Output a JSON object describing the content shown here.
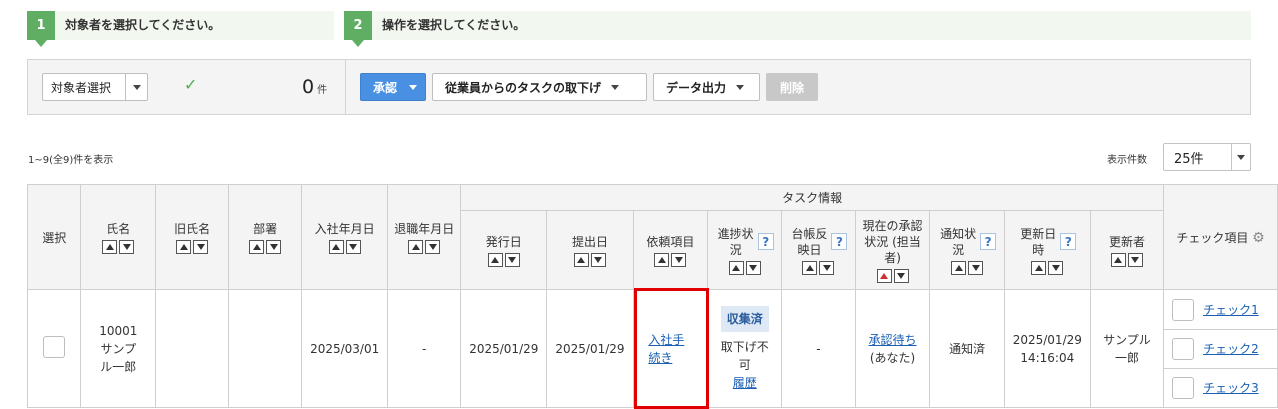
{
  "steps": [
    {
      "num": "1",
      "text": "対象者を選択してください。"
    },
    {
      "num": "2",
      "text": "操作を選択してください。"
    }
  ],
  "selector": {
    "label": "対象者選択",
    "count": "0",
    "unit": "件"
  },
  "actions": {
    "approve": "承認",
    "withdraw": "従業員からのタスクの取下げ",
    "export": "データ出力",
    "delete": "削除"
  },
  "summary": "1~9(全9)件を表示",
  "pageSize": {
    "label": "表示件数",
    "value": "25件"
  },
  "table": {
    "group": "タスク情報",
    "headers": {
      "select": "選択",
      "name": "氏名",
      "oldName": "旧氏名",
      "dept": "部署",
      "hireDate": "入社年月日",
      "retireDate": "退職年月日",
      "issueDate": "発行日",
      "submitDate": "提出日",
      "requestItem": "依頼項目",
      "progress": "進捗状況",
      "ledger": "台帳反映日",
      "approval": "現在の承認状況 (担当者)",
      "notify": "通知状況",
      "updated": "更新日時",
      "updater": "更新者",
      "check": "チェック項目"
    },
    "row": {
      "name": "10001 サンプル一郎",
      "oldName": "",
      "dept": "",
      "hireDate": "2025/03/01",
      "retireDate": "-",
      "issueDate": "2025/01/29",
      "submitDate": "2025/01/29",
      "requestItem": "入社手続き",
      "progressBadge": "収集済",
      "progressNote": "取下げ不可",
      "progressLink": "履歴",
      "ledger": "-",
      "approvalLink": "承認待ち",
      "approvalWho": "(あなた)",
      "notify": "通知済",
      "updated": "2025/01/29 14:16:04",
      "updater": "サンプル一郎",
      "checks": [
        "チェック1",
        "チェック2",
        "チェック3"
      ]
    }
  },
  "colors": {
    "green": "#5fae63",
    "blue": "#4a90e2",
    "highlight": "#e00000",
    "link": "#1a5fb4"
  }
}
